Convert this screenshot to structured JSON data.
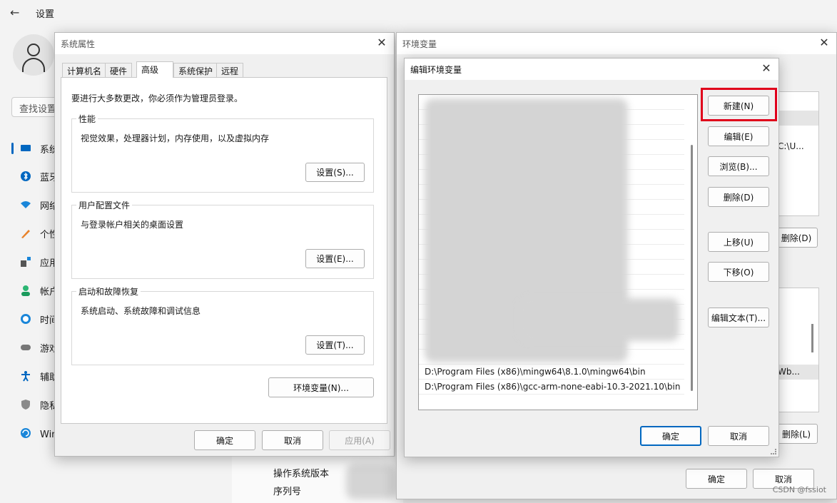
{
  "settings": {
    "title": "设置",
    "search_placeholder": "查找设置",
    "nav": [
      {
        "label": "系统",
        "icon": "monitor-icon"
      },
      {
        "label": "蓝牙和其他设备",
        "icon": "bluetooth-icon"
      },
      {
        "label": "网络和 Internet",
        "icon": "wifi-icon"
      },
      {
        "label": "个性化",
        "icon": "brush-icon"
      },
      {
        "label": "应用",
        "icon": "apps-icon"
      },
      {
        "label": "帐户",
        "icon": "account-icon"
      },
      {
        "label": "时间和语言",
        "icon": "clock-globe-icon"
      },
      {
        "label": "游戏",
        "icon": "gamepad-icon"
      },
      {
        "label": "辅助功能",
        "icon": "accessibility-icon"
      },
      {
        "label": "隐私和安全性",
        "icon": "shield-icon"
      },
      {
        "label": "Windows 更新",
        "icon": "update-icon"
      }
    ],
    "info": {
      "os_version_label": "操作系统版本",
      "serial_label": "序列号"
    }
  },
  "sysprop": {
    "title": "系统属性",
    "tabs": [
      "计算机名",
      "硬件",
      "高级",
      "系统保护",
      "远程"
    ],
    "active_tab": "高级",
    "admin_note": "要进行大多数更改，你必须作为管理员登录。",
    "performance": {
      "title": "性能",
      "desc": "视觉效果，处理器计划，内存使用，以及虚拟内存",
      "button": "设置(S)..."
    },
    "profile": {
      "title": "用户配置文件",
      "desc": "与登录帐户相关的桌面设置",
      "button": "设置(E)..."
    },
    "startup": {
      "title": "启动和故障恢复",
      "desc": "系统启动、系统故障和调试信息",
      "button": "设置(T)..."
    },
    "env_button": "环境变量(N)...",
    "ok": "确定",
    "cancel": "取消",
    "apply": "应用(A)"
  },
  "envwin": {
    "title": "环境变量",
    "user_value_fragment": "C:\\U...",
    "user_delete": "删除(D)",
    "sys_value_fragment": "Wb...",
    "sys_delete": "删除(L)",
    "ok": "确定",
    "cancel": "取消"
  },
  "editwin": {
    "title": "编辑环境变量",
    "paths": [
      "D:\\Program Files (x86)\\mingw64\\8.1.0\\mingw64\\bin",
      "D:\\Program Files (x86)\\gcc-arm-none-eabi-10.3-2021.10\\bin"
    ],
    "buttons": {
      "new": "新建(N)",
      "edit": "编辑(E)",
      "browse": "浏览(B)...",
      "delete": "删除(D)",
      "move_up": "上移(U)",
      "move_down": "下移(O)",
      "edit_text": "编辑文本(T)..."
    },
    "ok": "确定",
    "cancel": "取消"
  },
  "watermark": "CSDN @fssiot"
}
